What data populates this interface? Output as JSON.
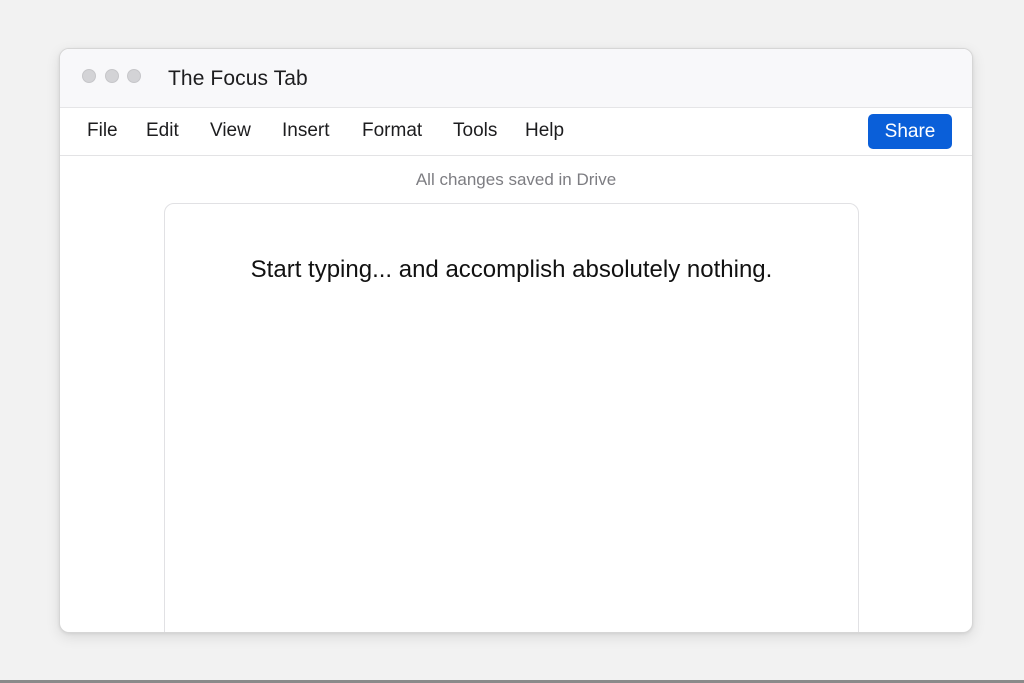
{
  "window": {
    "title": "The Focus Tab"
  },
  "menu": {
    "items": [
      {
        "label": "File"
      },
      {
        "label": "Edit"
      },
      {
        "label": "View"
      },
      {
        "label": "Insert"
      },
      {
        "label": "Format"
      },
      {
        "label": "Tools"
      },
      {
        "label": "Help"
      }
    ],
    "share_label": "Share"
  },
  "status": {
    "save_text": "All changes saved in Drive"
  },
  "document": {
    "placeholder": "Start typing... and accomplish absolutely nothing."
  },
  "colors": {
    "accent": "#0a5fd9",
    "window_chrome": "#f8f8fa",
    "traffic_light": "#d3d3d6",
    "status_text": "#7d7d82"
  },
  "icons": {
    "traffic_lights": [
      "close-dot-icon",
      "minimize-dot-icon",
      "zoom-dot-icon"
    ]
  }
}
